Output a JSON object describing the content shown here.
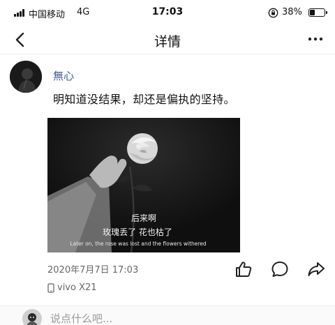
{
  "status_bar": {
    "carrier": "中国移动",
    "network": "4G",
    "time": "17:03",
    "battery_percent": "38%",
    "battery_level": 0.38
  },
  "nav": {
    "title": "详情",
    "icons": [
      "chevron-left-icon",
      "more-dots-icon"
    ]
  },
  "post": {
    "username": "無心",
    "text": "明知道没结果，却还是偏执的坚持。",
    "image": {
      "caption_line1": "后来啊",
      "caption_line2": "玫瑰丢了  花也枯了",
      "caption_english": "Later on, the rose was lost and the flowers withered"
    },
    "timestamp": "2020年7月7日  17:03",
    "device": "vivo X21",
    "actions": [
      "thumbs-up-icon",
      "comment-icon",
      "share-icon"
    ]
  },
  "comment_box": {
    "placeholder": "说点什么吧..."
  },
  "colors": {
    "username": "#3e5a8c",
    "meta_text": "#666666",
    "image_bg": "#141414"
  }
}
